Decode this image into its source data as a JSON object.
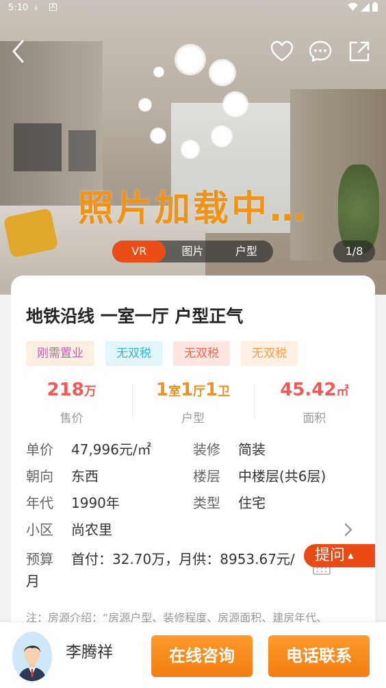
{
  "status_bar": {
    "time": "5:10"
  },
  "hero": {
    "loading_text": "照片加载中…",
    "tabs": [
      {
        "label": "VR",
        "active": true
      },
      {
        "label": "图片",
        "active": false
      },
      {
        "label": "户型",
        "active": false
      }
    ],
    "photo_counter": "1/8"
  },
  "listing": {
    "title": "地铁沿线 一室一厅 户型正气",
    "tags": [
      {
        "label": "刚需置业",
        "color": "#c75ac6",
        "bg": "#fdeee2"
      },
      {
        "label": "无双税",
        "color": "#33b7d6",
        "bg": "#e2f6fa"
      },
      {
        "label": "无双税",
        "color": "#ee6a56",
        "bg": "#fde6e1"
      },
      {
        "label": "无双税",
        "color": "#f4a247",
        "bg": "#fdf0e2"
      }
    ],
    "stats": {
      "price": {
        "value": "218",
        "unit": "万",
        "label": "售价",
        "color": "#ef5a56"
      },
      "layout": {
        "n1": "1",
        "u1": "室",
        "n2": "1",
        "u2": "厅",
        "n3": "1",
        "u3": "卫",
        "label": "户型",
        "color": "#f08f22"
      },
      "area": {
        "value": "45.42",
        "unit": "㎡",
        "label": "面积",
        "color": "#ef5a56"
      }
    },
    "info": {
      "unit_price": {
        "k": "单价",
        "v": "47,996元/㎡"
      },
      "decoration": {
        "k": "装修",
        "v": "简装"
      },
      "orientation": {
        "k": "朝向",
        "v": "东西"
      },
      "floor": {
        "k": "楼层",
        "v": "中楼层(共6层)"
      },
      "year": {
        "k": "年代",
        "v": "1990年"
      },
      "type": {
        "k": "类型",
        "v": "住宅"
      },
      "community": {
        "k": "小区",
        "v": "尚农里"
      }
    },
    "budget": {
      "k": "预算",
      "v": "首付：32.70万，月供：8953.67元/",
      "v2": "月"
    },
    "note": "注：房源介绍：“房源户型、装修程度、房源面积、建房年代、"
  },
  "ask_button": "提问",
  "agent": {
    "name": "李腾祥"
  },
  "actions": {
    "consult": "在线咨询",
    "call": "电话联系"
  }
}
